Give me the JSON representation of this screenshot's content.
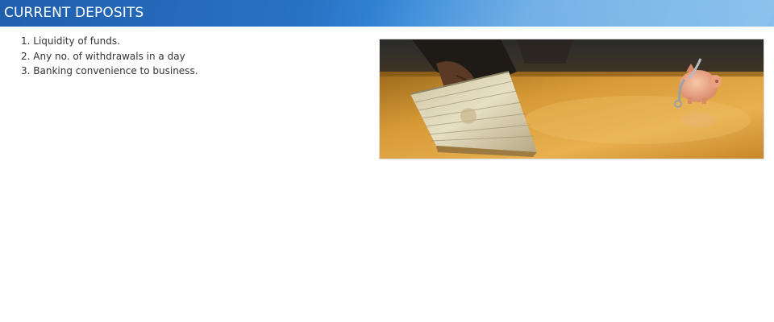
{
  "header": {
    "title": "CURRENT DEPOSITS"
  },
  "features": [
    "1. Liquidity of funds.",
    "2. Any no. of withdrawals in a day",
    "3. Banking convenience to business."
  ],
  "image": {
    "subject": "hand holding stack of banknotes beside piggy bank on wooden desk"
  },
  "colors": {
    "header_start": "#1f5fae",
    "header_end": "#86c0ec",
    "header_text": "#ffffff",
    "body_text": "#333333"
  }
}
